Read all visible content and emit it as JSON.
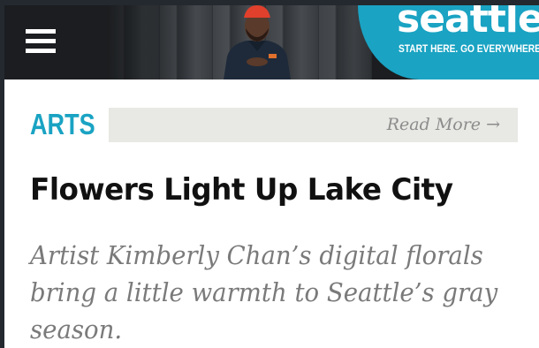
{
  "header": {
    "menu_icon": "hamburger-menu-icon",
    "brand": {
      "logo_text": "seattle",
      "tagline": "START HERE. GO EVERYWHERE",
      "color": "#1aa3c3"
    }
  },
  "article": {
    "section": "ARTS",
    "read_more_label": "Read More →",
    "headline": "Flowers Light Up Lake City",
    "dek": "Artist Kimberly Chan’s digital florals bring a little warmth to Seattle’s gray season."
  }
}
